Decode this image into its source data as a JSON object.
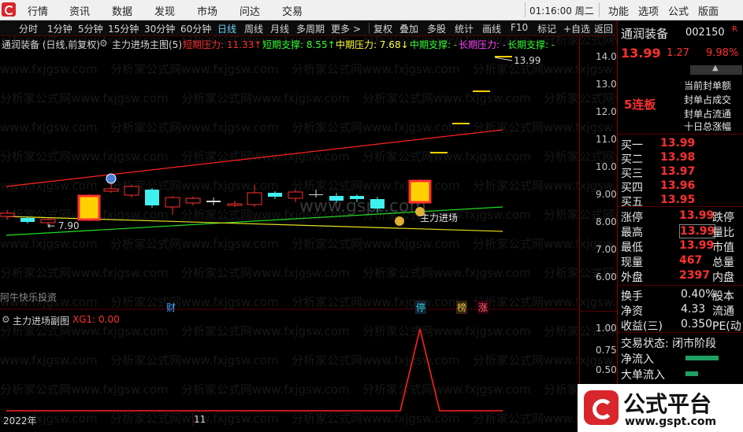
{
  "menubar": {
    "items": [
      "行情",
      "资讯",
      "数据",
      "发现",
      "市场",
      "问达",
      "交易"
    ],
    "clock": "01:16:00 周二",
    "right_items": [
      "功能",
      "选项",
      "公式",
      "版面"
    ]
  },
  "toolbar": {
    "periods": [
      "分时",
      "1分钟",
      "5分钟",
      "15分钟",
      "30分钟",
      "60分钟",
      "日线",
      "周线",
      "月线",
      "多周期",
      "更多 >"
    ],
    "active_period": "日线",
    "tools": [
      "复权",
      "叠加",
      "多股",
      "统计",
      "画线",
      "F10",
      "标记",
      "+自选",
      "返回"
    ]
  },
  "title_line": {
    "stock": "通润装备 (日线,前复权)",
    "formula": "主力进场主图(5)",
    "short_pressure": "短期压力: 11.33↑",
    "short_support": "短期支撑: 8.55↑",
    "mid_pressure": "中期压力: 7.68↓",
    "mid_support": "中期支撑: -",
    "long_pressure": "长期压力: -",
    "long_support": "长期支撑: -",
    "colors": {
      "short_pressure": "#ff3030",
      "short_support": "#30ff30",
      "mid_pressure": "#ffff40",
      "mid_support": "#30ff30",
      "long_pressure": "#ff40ff",
      "long_support": "#30ff30"
    }
  },
  "main_chart": {
    "high_label": "13.99",
    "low_label": "← 7.90",
    "signal_label": "主力进场",
    "source_label": "阿牛快乐投资",
    "markers": [
      "财",
      "停",
      "榜",
      "涨"
    ]
  },
  "price_axis": [
    "14.00",
    "13.00",
    "12.00",
    "11.00",
    "10.00",
    "9.00",
    "8.00",
    "7.00",
    "6.00"
  ],
  "sub_chart": {
    "title": "主力进场副图",
    "value": "XG1: 0.00",
    "axis": [
      "1.00",
      "0.75",
      "0.50"
    ]
  },
  "time_axis": {
    "year": "2022年",
    "month": "11"
  },
  "panel": {
    "name": "通润装备",
    "code": "002150",
    "price": "13.99",
    "change": "1.27",
    "pct": "9.98%",
    "board_tag": "5连板",
    "board_info": [
      "当前封单额",
      "封单占成交",
      "封单占流通",
      "十日总涨幅"
    ],
    "book": [
      {
        "label": "买一",
        "price": "13.99"
      },
      {
        "label": "买二",
        "price": "13.98"
      },
      {
        "label": "买三",
        "price": "13.97"
      },
      {
        "label": "买四",
        "price": "13.96"
      },
      {
        "label": "买五",
        "price": "13.95"
      }
    ],
    "stats": [
      {
        "label": "涨停",
        "value": "13.99",
        "r": "跌停"
      },
      {
        "label": "最高",
        "value": "13.99",
        "r": "量比"
      },
      {
        "label": "最低",
        "value": "13.99",
        "r": "市值"
      },
      {
        "label": "现量",
        "value": "467",
        "r": "总量"
      },
      {
        "label": "外盘",
        "value": "2397",
        "r": "内盘"
      }
    ],
    "stats2": [
      {
        "label": "换手",
        "value": "0.40%",
        "r": "股本"
      },
      {
        "label": "净资",
        "value": "4.33",
        "r": "流通"
      },
      {
        "label": "收益(三)",
        "value": "0.350",
        "r": "PE(动"
      }
    ],
    "trade_status": "交易状态: 闭市阶段",
    "net_inflow": "净流入",
    "big_inflow": "大单流入"
  },
  "brand": {
    "name": "公式平台",
    "url": "www.gspt.com"
  },
  "watermark": {
    "text": "分析家公式网www.fxjgsw.com",
    "center": "www.gspt.com"
  }
}
